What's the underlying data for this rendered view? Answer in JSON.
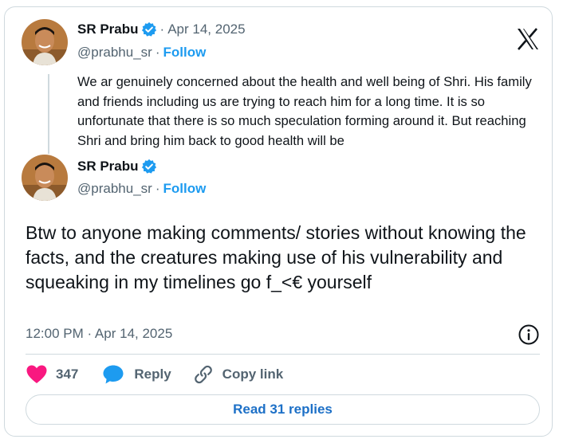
{
  "quoted_tweet": {
    "name": "SR Prabu",
    "date": "Apr 14, 2025",
    "handle": "@prabhu_sr",
    "follow_label": "Follow",
    "text": "We ar genuinely concerned about the health and well being of Shri. His family and friends including us are trying to reach him for a long time. It is so unfortunate that there is so much speculation forming around it. But reaching Shri and bring him back to good health will be"
  },
  "main_tweet": {
    "name": "SR Prabu",
    "handle": "@prabhu_sr",
    "follow_label": "Follow",
    "text": "Btw to anyone making comments/ stories without knowing the facts, and the creatures making use of his vulnerability and squeaking in my timelines go f_<€ yourself",
    "timestamp": "12:00 PM · Apr 14, 2025"
  },
  "actions": {
    "like_count": "347",
    "reply_label": "Reply",
    "copy_link_label": "Copy link"
  },
  "read_replies_label": "Read 31 replies",
  "icons": {
    "verified": "verified-badge-icon",
    "x_logo": "x-logo-icon",
    "info": "info-icon",
    "heart": "heart-icon",
    "reply": "reply-bubble-icon",
    "link": "link-icon"
  },
  "colors": {
    "accent": "#1d9bf0",
    "link_button": "#1d70c7",
    "like": "#f91880",
    "muted": "#536471",
    "border": "#cfd9de"
  }
}
